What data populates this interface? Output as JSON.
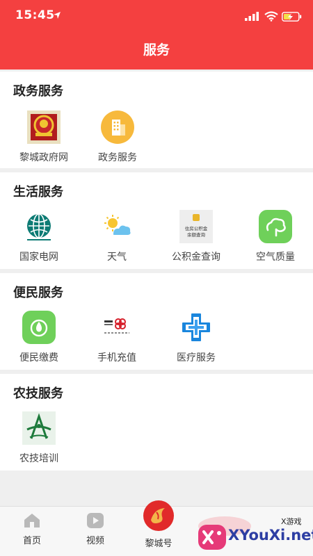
{
  "status_bar": {
    "time": "15:45"
  },
  "header": {
    "title": "服务"
  },
  "sections": [
    {
      "title": "政务服务",
      "items": [
        {
          "label": "黎城政府网",
          "icon": "government-emblem-icon"
        },
        {
          "label": "政务服务",
          "icon": "building-icon"
        }
      ]
    },
    {
      "title": "生活服务",
      "items": [
        {
          "label": "国家电网",
          "icon": "state-grid-icon"
        },
        {
          "label": "天气",
          "icon": "weather-icon"
        },
        {
          "label": "公积金查询",
          "icon": "housing-fund-icon"
        },
        {
          "label": "空气质量",
          "icon": "air-quality-icon"
        }
      ]
    },
    {
      "title": "便民服务",
      "items": [
        {
          "label": "便民缴费",
          "icon": "payment-icon"
        },
        {
          "label": "手机充值",
          "icon": "china-unicom-icon"
        },
        {
          "label": "医疗服务",
          "icon": "medical-cross-icon"
        }
      ]
    },
    {
      "title": "农技服务",
      "items": [
        {
          "label": "农技培训",
          "icon": "agri-training-icon"
        }
      ]
    }
  ],
  "icon_texts": {
    "housing_fund_line1": "住房公积金",
    "housing_fund_line2": "余额查询"
  },
  "tabbar": {
    "home": "首页",
    "video": "视频",
    "licheng": "黎城号"
  },
  "watermark": {
    "site": "XYouXi.net",
    "tag": "X游戏"
  },
  "colors": {
    "brand_red": "#f44040",
    "section_bg": "#ffffff",
    "page_bg": "#efefef"
  }
}
